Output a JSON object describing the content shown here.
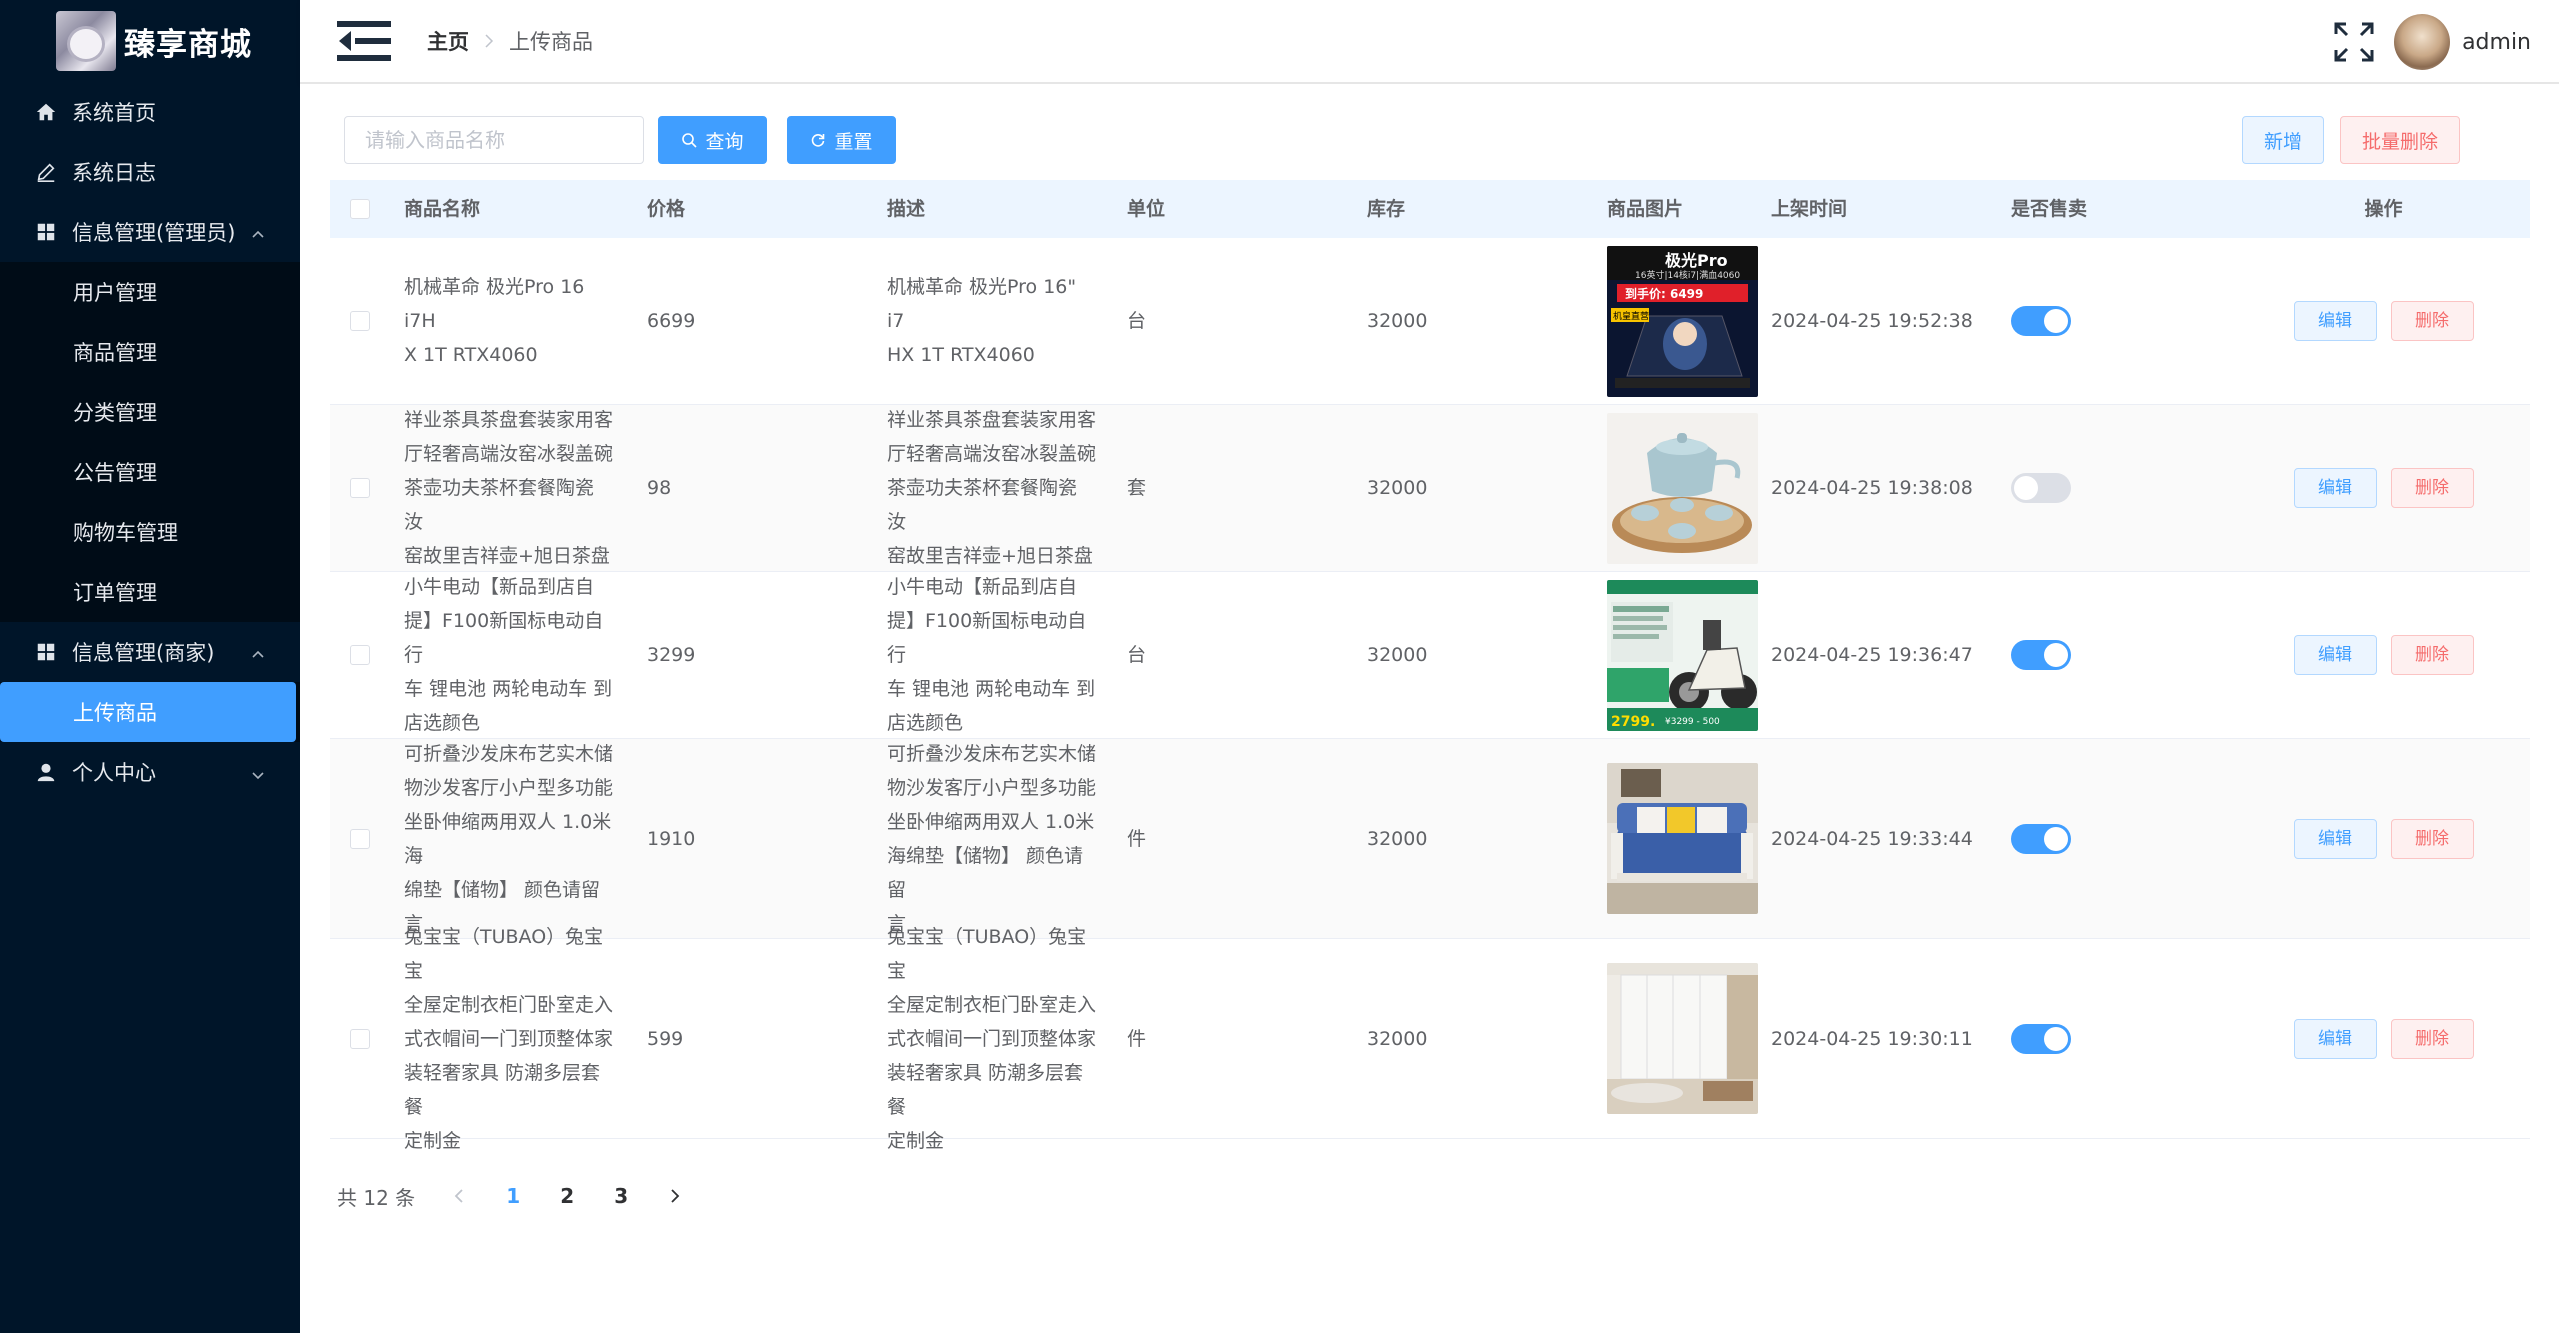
{
  "app": {
    "title": "臻享商城"
  },
  "sidebar": {
    "items": [
      {
        "label": "系统首页",
        "icon": "home-icon"
      },
      {
        "label": "系统日志",
        "icon": "edit-icon"
      }
    ],
    "groups": [
      {
        "label": "信息管理(管理员)",
        "icon": "grid-icon",
        "expanded": true,
        "items": [
          "用户管理",
          "商品管理",
          "分类管理",
          "公告管理",
          "购物车管理",
          "订单管理"
        ]
      },
      {
        "label": "信息管理(商家)",
        "icon": "grid-icon",
        "expanded": true,
        "items": [
          "上传商品"
        ]
      },
      {
        "label": "个人中心",
        "icon": "user-icon",
        "expanded": false,
        "items": []
      }
    ],
    "active_item": "上传商品"
  },
  "header": {
    "breadcrumb": {
      "home": "主页",
      "current": "上传商品"
    },
    "username": "admin"
  },
  "toolbar": {
    "search_placeholder": "请输入商品名称",
    "query_label": "查询",
    "reset_label": "重置",
    "add_label": "新增",
    "batch_delete_label": "批量删除"
  },
  "table": {
    "headers": {
      "name": "商品名称",
      "price": "价格",
      "desc": "描述",
      "unit": "单位",
      "stock": "库存",
      "image": "商品图片",
      "time": "上架时间",
      "on_sale": "是否售卖",
      "ops": "操作"
    },
    "edit_label": "编辑",
    "delete_label": "删除",
    "rows": [
      {
        "name": [
          "机械革命 极光Pro 16 i7H",
          "X 1T RTX4060"
        ],
        "price": "6699",
        "desc": [
          "机械革命 极光Pro 16\" i7",
          "HX 1T RTX4060"
        ],
        "unit": "台",
        "stock": "32000",
        "time": "2024-04-25 19:52:38",
        "on_sale": true,
        "image_texts": {
          "brand": "极光Pro",
          "spec": "16英寸|14核i7|满血4060",
          "price": "到手价: 6499",
          "tag": "机皇直营"
        }
      },
      {
        "name": [
          "祥业茶具茶盘套装家用客",
          "厅轻奢高端汝窑冰裂盖碗",
          "茶壶功夫茶杯套餐陶瓷 汝",
          "窑故里吉祥壶+旭日茶盘"
        ],
        "price": "98",
        "desc": [
          "祥业茶具茶盘套装家用客",
          "厅轻奢高端汝窑冰裂盖碗",
          "茶壶功夫茶杯套餐陶瓷 汝",
          "窑故里吉祥壶+旭日茶盘"
        ],
        "unit": "套",
        "stock": "32000",
        "time": "2024-04-25 19:38:08",
        "on_sale": false
      },
      {
        "name": [
          "小牛电动【新品到店自",
          "提】F100新国标电动自行",
          "车 锂电池 两轮电动车 到",
          "店选颜色"
        ],
        "price": "3299",
        "desc": [
          "小牛电动【新品到店自",
          "提】F100新国标电动自行",
          "车 锂电池 两轮电动车 到",
          "店选颜色"
        ],
        "unit": "台",
        "stock": "32000",
        "time": "2024-04-25 19:36:47",
        "on_sale": true,
        "image_texts": {
          "price": "2799.",
          "coupon": "¥3299 - 500"
        }
      },
      {
        "name": [
          "可折叠沙发床布艺实木储",
          "物沙发客厅小户型多功能",
          "坐卧伸缩两用双人 1.0米海",
          "绵垫【储物】 颜色请留言"
        ],
        "price": "1910",
        "desc": [
          "可折叠沙发床布艺实木储",
          "物沙发客厅小户型多功能",
          "坐卧伸缩两用双人 1.0米",
          "海绵垫【储物】 颜色请留",
          "言"
        ],
        "unit": "件",
        "stock": "32000",
        "time": "2024-04-25 19:33:44",
        "on_sale": true
      },
      {
        "name": [
          "兔宝宝（TUBAO）兔宝宝",
          "全屋定制衣柜门卧室走入",
          "式衣帽间一门到顶整体家",
          "装轻奢家具 防潮多层套餐",
          "定制金"
        ],
        "price": "599",
        "desc": [
          "兔宝宝（TUBAO）兔宝宝",
          "全屋定制衣柜门卧室走入",
          "式衣帽间一门到顶整体家",
          "装轻奢家具 防潮多层套餐",
          "定制金"
        ],
        "unit": "件",
        "stock": "32000",
        "time": "2024-04-25 19:30:11",
        "on_sale": true
      }
    ]
  },
  "pagination": {
    "total_text": "共 12 条",
    "pages": [
      "1",
      "2",
      "3"
    ],
    "current": "1"
  },
  "colors": {
    "sidebar_bg": "#001529",
    "primary": "#409eff",
    "danger": "#f56c6c"
  }
}
